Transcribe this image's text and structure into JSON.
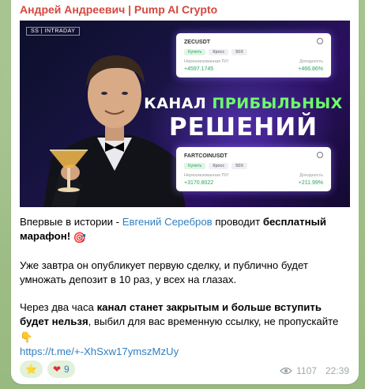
{
  "message": {
    "sender": "Андрей Андреевич | Pump AI Crypto",
    "media": {
      "corner_tag": "SS | INTRADAY",
      "headline_line1_part1": "КАНАЛ",
      "headline_line1_accent": "ПРИБЫЛЬНЫХ",
      "headline_line2": "РЕШЕНИЙ",
      "cards": [
        {
          "symbol": "ZECUSDT",
          "chip_buy": "Купить",
          "chip_cross": "Кросс",
          "chip_leverage": "50X",
          "label_pnl": "Нереализованная П/У",
          "label_return": "Доходность",
          "pnl": "+4597.1745",
          "return": "+466.86%"
        },
        {
          "symbol": "FARTCOINUSDT",
          "chip_buy": "Купить",
          "chip_cross": "Кросс",
          "chip_leverage": "50X",
          "label_pnl": "Нереализованная П/У",
          "label_return": "Доходность",
          "pnl": "+3170.8022",
          "return": "+211.99%"
        }
      ]
    },
    "paragraph1": {
      "prefix": "Впервые в истории - ",
      "name_link": "Евгений Серебров",
      "middle": " проводит ",
      "bold": "бесплатный марафон!",
      "emoji": "🎯"
    },
    "paragraph2": "Уже завтра он опубликует первую сделку, и публично будет умножать депозит в 10 раз, у всех на глазах.",
    "paragraph3": {
      "prefix": "Через два часа ",
      "bold": "канал станет закрытым и больше вступить будет нельзя",
      "suffix": ", выбил для вас временную ссылку, не пропускайте",
      "emoji": "👇"
    },
    "invite_link": "https://t.me/+-XhSxw17ymszMzUy",
    "reactions": [
      {
        "emoji": "⭐",
        "count": ""
      },
      {
        "emoji": "❤",
        "count": "9"
      }
    ],
    "views": "1107",
    "time": "22:39"
  },
  "colors": {
    "sender": "#d4483f",
    "link": "#2f7fc1",
    "accent_green": "#6dfc6a",
    "chat_background": "#9fc08a"
  }
}
